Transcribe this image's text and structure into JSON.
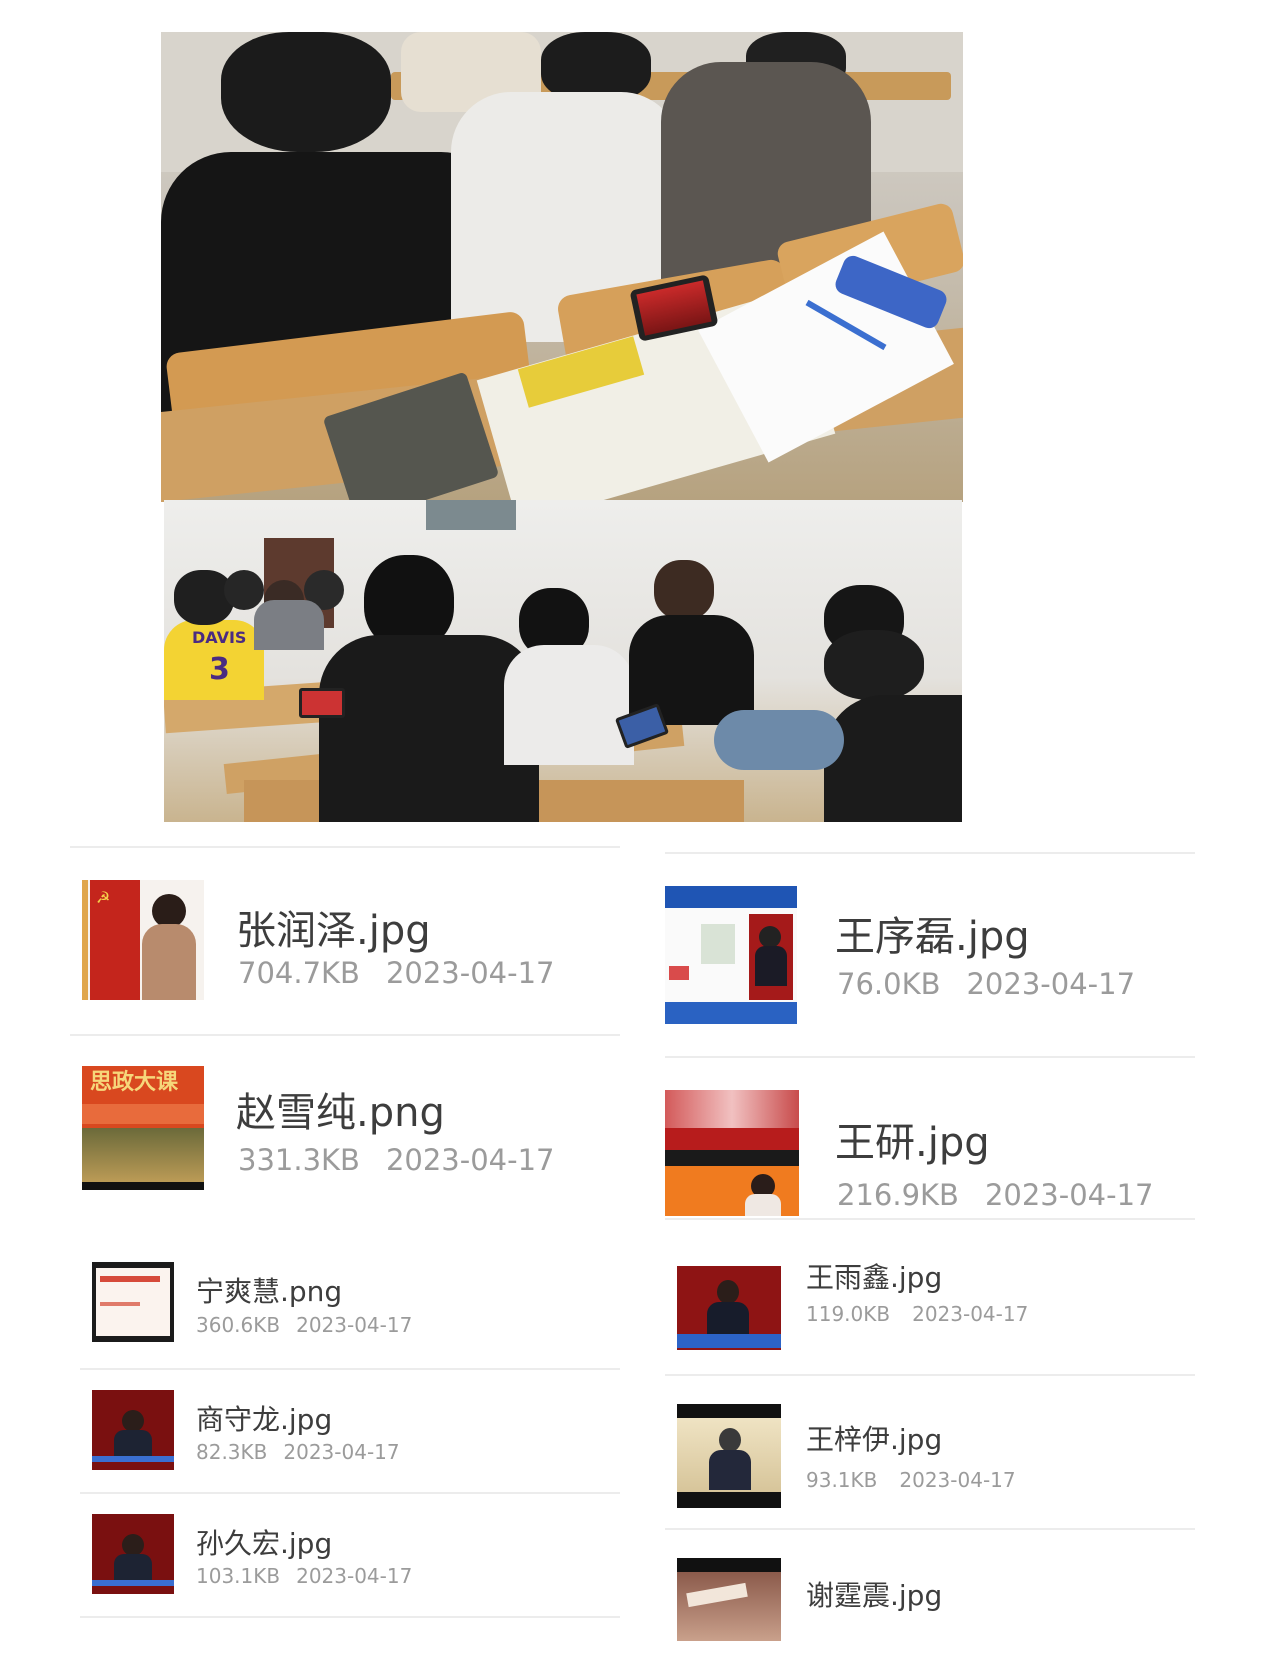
{
  "photos": {
    "top_shirt_text": "DAVIS",
    "top_jersey_number": "3"
  },
  "files_left": [
    {
      "name": "张润泽.jpg",
      "size": "704.7KB",
      "date": "2023-04-17"
    },
    {
      "name": "赵雪纯.png",
      "size": "331.3KB",
      "date": "2023-04-17",
      "thumb_caption": "思政大课"
    },
    {
      "name": "宁爽慧.png",
      "size": "360.6KB",
      "date": "2023-04-17"
    },
    {
      "name": "商守龙.jpg",
      "size": "82.3KB",
      "date": "2023-04-17"
    },
    {
      "name": "孙久宏.jpg",
      "size": "103.1KB",
      "date": "2023-04-17"
    }
  ],
  "files_right": [
    {
      "name": "王序磊.jpg",
      "size": "76.0KB",
      "date": "2023-04-17"
    },
    {
      "name": "王研.jpg",
      "size": "216.9KB",
      "date": "2023-04-17"
    },
    {
      "name": "王雨鑫.jpg",
      "size": "119.0KB",
      "date": "2023-04-17"
    },
    {
      "name": "王梓伊.jpg",
      "size": "93.1KB",
      "date": "2023-04-17"
    },
    {
      "name": "谢霆震.jpg",
      "size": "",
      "date": ""
    }
  ],
  "colors": {
    "row_separator": "#ececec",
    "file_name_text": "#3d3d3d",
    "file_meta_text": "#9b9b9b"
  }
}
